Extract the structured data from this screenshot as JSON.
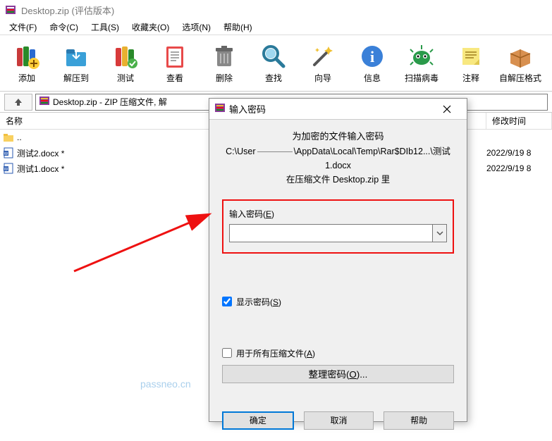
{
  "window": {
    "title": "Desktop.zip (评估版本)"
  },
  "menu": {
    "file": "文件(F)",
    "commands": "命令(C)",
    "tools": "工具(S)",
    "favorites": "收藏夹(O)",
    "options": "选项(N)",
    "help": "帮助(H)"
  },
  "toolbar": {
    "add": "添加",
    "extract": "解压到",
    "test": "测试",
    "view": "查看",
    "delete": "删除",
    "find": "查找",
    "wizard": "向导",
    "info": "信息",
    "scan": "扫描病毒",
    "comment": "注释",
    "sfx": "自解压格式"
  },
  "address": {
    "path": "Desktop.zip - ZIP 压缩文件, 解"
  },
  "columns": {
    "name": "名称",
    "modified": "修改时间"
  },
  "rows": {
    "up": "..",
    "f1": "测试2.docx *",
    "f2": "测试1.docx *",
    "d1": "2022/9/19 8",
    "d2": "2022/9/19 8"
  },
  "dialog": {
    "title": "输入密码",
    "line1": "为加密的文件输入密码",
    "line2a": "C:\\User",
    "line2b": "\\AppData\\Local\\Temp\\Rar$DIb12...\\测试1.docx",
    "line3": "在压缩文件 Desktop.zip 里",
    "pw_label_pre": "输入密码(",
    "pw_label_u": "E",
    "pw_label_post": ")",
    "show_pre": "显示密码(",
    "show_u": "S",
    "show_post": ")",
    "all_pre": "用于所有压缩文件(",
    "all_u": "A",
    "all_post": ")",
    "manage_pre": "整理密码(",
    "manage_u": "O",
    "manage_post": ")...",
    "ok": "确定",
    "cancel": "取消",
    "help": "帮助"
  },
  "watermark": "passneo.cn"
}
